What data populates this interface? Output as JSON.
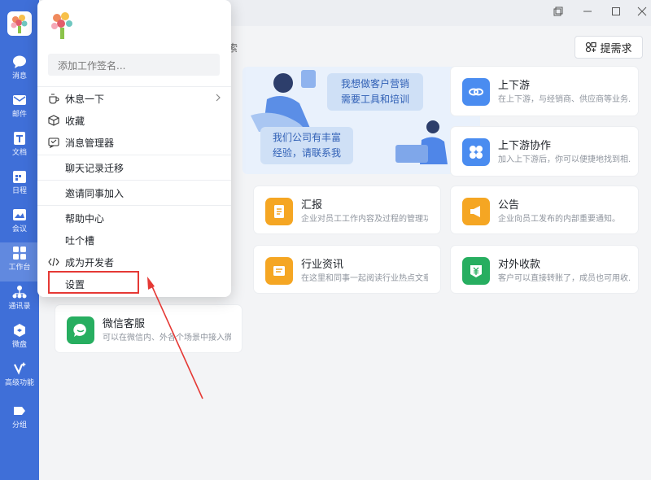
{
  "nav": {
    "items": [
      {
        "key": "messages",
        "label": "消息",
        "icon": "chat-icon"
      },
      {
        "key": "mail",
        "label": "邮件",
        "icon": "mail-icon"
      },
      {
        "key": "docs",
        "label": "文档",
        "icon": "doc-icon"
      },
      {
        "key": "calendar",
        "label": "日程",
        "icon": "calendar-icon"
      },
      {
        "key": "meeting",
        "label": "会议",
        "icon": "meeting-icon"
      },
      {
        "key": "workbench",
        "label": "工作台",
        "icon": "grid-icon"
      },
      {
        "key": "contacts",
        "label": "通讯录",
        "icon": "contacts-icon"
      },
      {
        "key": "drive",
        "label": "微盘",
        "icon": "drive-icon"
      },
      {
        "key": "advanced",
        "label": "高级功能",
        "icon": "sparkle-icon"
      },
      {
        "key": "group",
        "label": "分组",
        "icon": "tag-icon"
      }
    ],
    "active": "workbench"
  },
  "header": {
    "request_button": "提需求",
    "search_fragment": "索"
  },
  "banner": {
    "bubble1_line1": "我想做客户营销",
    "bubble1_line2": "需要工具和培训",
    "bubble2_line1": "我们公司有丰富",
    "bubble2_line2": "经验，请联系我"
  },
  "apps": [
    {
      "title": "上下游",
      "desc": "在上下游，与经销商、供应商等业务...",
      "color": "#4a8cf0"
    },
    {
      "title": "上下游协作",
      "desc": "加入上下游后，你可以便捷地找到相...",
      "color": "#4a8cf0"
    },
    {
      "title": "汇报",
      "desc": "企业对员工工作内容及过程的管理功...",
      "color": "#f5a623"
    },
    {
      "title": "公告",
      "desc": "企业向员工发布的内部重要通知。",
      "color": "#f5a623"
    },
    {
      "title": "行业资讯",
      "desc": "在这里和同事一起阅读行业热点文章...",
      "color": "#f5a623"
    },
    {
      "title": "对外收款",
      "desc": "客户可以直接转账了，成员也可用收...",
      "color": "#27ae60"
    },
    {
      "title": "微信客服",
      "desc": "可以在微信内、外各个场景中接入微...",
      "color": "#27ae60"
    }
  ],
  "popup": {
    "signature_placeholder": "添加工作签名...",
    "menu": [
      {
        "label": "休息一下",
        "icon": "coffee-icon",
        "submenu": true
      },
      {
        "label": "收藏",
        "icon": "box-icon"
      },
      {
        "label": "消息管理器",
        "icon": "message-manager-icon"
      },
      {
        "label": "聊天记录迁移"
      },
      {
        "label": "邀请同事加入"
      },
      {
        "label": "帮助中心"
      },
      {
        "label": "吐个槽"
      },
      {
        "label": "成为开发者",
        "icon": "code-icon"
      },
      {
        "label": "设置"
      }
    ]
  },
  "annotation": {
    "highlight_color": "#e53935"
  }
}
